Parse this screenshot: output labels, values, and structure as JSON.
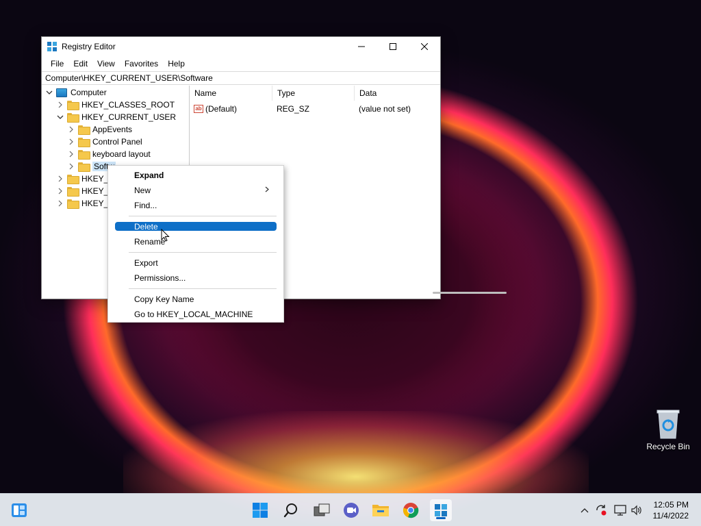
{
  "window": {
    "title": "Registry Editor",
    "menu": [
      "File",
      "Edit",
      "View",
      "Favorites",
      "Help"
    ],
    "address": "Computer\\HKEY_CURRENT_USER\\Software"
  },
  "tree": {
    "root": "Computer",
    "items": [
      {
        "label": "HKEY_CLASSES_ROOT"
      },
      {
        "label": "HKEY_CURRENT_USER"
      },
      {
        "label": "AppEvents"
      },
      {
        "label": "Control Panel"
      },
      {
        "label": "keyboard layout"
      },
      {
        "label": "Softw"
      },
      {
        "label": "HKEY_L"
      },
      {
        "label": "HKEY_U"
      },
      {
        "label": "HKEY_C"
      }
    ]
  },
  "list": {
    "columns": [
      "Name",
      "Type",
      "Data"
    ],
    "rows": [
      {
        "name": "(Default)",
        "type": "REG_SZ",
        "data": "(value not set)",
        "icon": "ab"
      }
    ]
  },
  "context_menu": {
    "items": [
      {
        "label": "Expand"
      },
      {
        "label": "New"
      },
      {
        "label": "Find..."
      },
      {
        "label": "Delete"
      },
      {
        "label": "Rename"
      },
      {
        "label": "Export"
      },
      {
        "label": "Permissions..."
      },
      {
        "label": "Copy Key Name"
      },
      {
        "label": "Go to HKEY_LOCAL_MACHINE"
      }
    ],
    "highlighted": "Delete"
  },
  "desktop": {
    "recycle_bin": "Recycle Bin"
  },
  "taskbar": {
    "time": "12:05 PM",
    "date": "11/4/2022"
  },
  "colors": {
    "accent": "#0e6fc7",
    "selection": "#cce4f7",
    "folder": "#f5c84c"
  }
}
